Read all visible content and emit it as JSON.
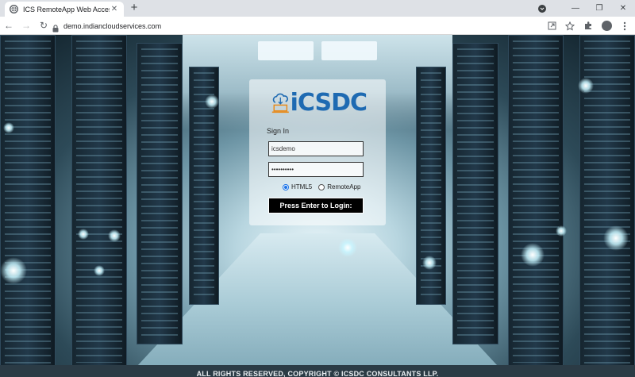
{
  "browser": {
    "tab_title": "ICS RemoteApp Web Access",
    "tab_close": "✕",
    "new_tab": "+",
    "url": "demo.indiancloudservices.com",
    "nav": {
      "back": "←",
      "forward": "→",
      "reload": "↻"
    },
    "window": {
      "minimize": "—",
      "restore": "❐",
      "close": "✕"
    },
    "icons": [
      "globe-icon",
      "lock-icon",
      "open-in-app-icon",
      "star-icon",
      "extensions-icon",
      "profile-icon",
      "menu-icon"
    ]
  },
  "login": {
    "logo_text": "iCSDC",
    "signin_label": "Sign In",
    "username_value": "icsdemo",
    "password_value": "••••••••••",
    "radio_options": [
      {
        "label": "HTML5",
        "checked": true
      },
      {
        "label": "RemoteApp",
        "checked": false
      }
    ],
    "submit_label": "Press Enter to Login:"
  },
  "footer": {
    "text": "ALL RIGHTS RESERVED, COPYRIGHT © ICSDC CONSULTANTS LLP."
  },
  "colors": {
    "logo_blue": "#1e6ab2",
    "logo_orange": "#e88a1a",
    "button_bg": "#000000",
    "footer_bg": "#2b3b45"
  }
}
